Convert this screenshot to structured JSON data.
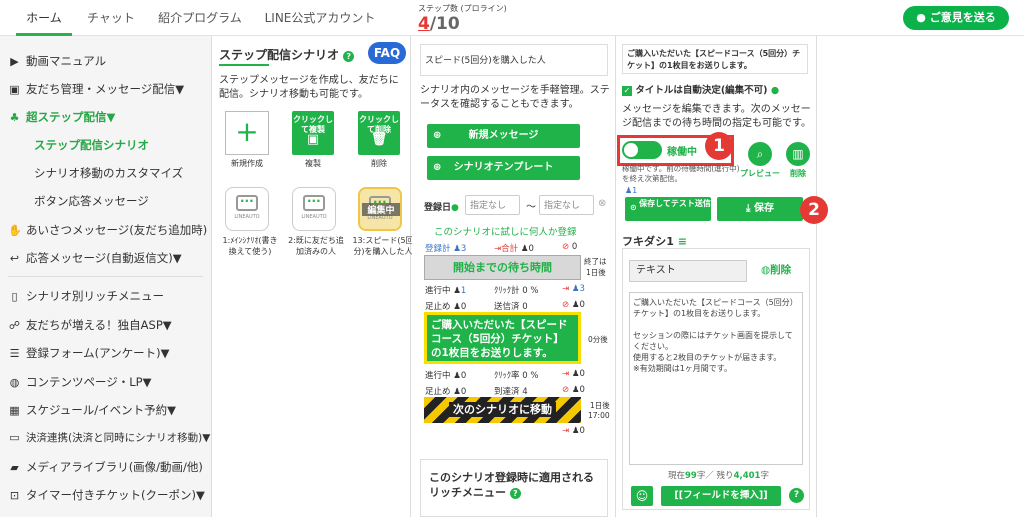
{
  "nav": {
    "tabs": [
      "ホーム",
      "チャット",
      "紹介プログラム",
      "LINE公式アカウント"
    ]
  },
  "step": {
    "label": "ステップ数 (プロライン)",
    "current": "4",
    "total": "/10"
  },
  "feedback_label": "ご意見を送る",
  "sidebar": {
    "items": [
      "動画マニュアル",
      "友だち管理・メッセージ配信▼",
      "超ステップ配信▼",
      "あいさつメッセージ(友だち追加時)",
      "応答メッセージ(自動返信文)▼",
      "シナリオ別リッチメニュー",
      "友だちが増える！独自ASP▼",
      "登録フォーム(アンケート)▼",
      "コンテンツページ・LP▼",
      "スケジュール/イベント予約▼",
      "決済連携(決済と同時にシナリオ移動)▼",
      "メディアライブラリ(画像/動画/他)",
      "タイマー付きチケット(クーポン)▼"
    ],
    "subs": [
      "ステップ配信シナリオ",
      "シナリオ移動のカスタマイズ",
      "ボタン応答メッセージ"
    ]
  },
  "col2": {
    "title": "ステップ配信シナリオ",
    "help": "?",
    "faq": "FAQ",
    "desc": "ステップメッセージを作成し、友だちに配信。シナリオ移動も可能です。",
    "actions": [
      {
        "btn": "",
        "label": "新規作成"
      },
      {
        "btn": "クリックして複製",
        "label": "複製"
      },
      {
        "btn": "クリックして削除",
        "label": "削除"
      }
    ],
    "cards": [
      {
        "label": "1:ﾒｲﾝｼﾅﾘｵ(書き換えて使う)",
        "logo": "LINEAUTO"
      },
      {
        "label": "2:既に友だち追加済みの人",
        "logo": "LINEAUTO"
      },
      {
        "label": "13:スピード(5回分)を購入した人",
        "logo": "LINEAUTO",
        "badge": "編集中"
      }
    ]
  },
  "col3": {
    "header": "スピード(5回分)を購入した人",
    "desc": "シナリオ内のメッセージを手軽管理。ステータスを確認することもできます。",
    "new_msg": "新規メッセージ",
    "template": "シナリオテンプレート",
    "reg_label": "登録日",
    "date_from": "指定なし",
    "tilde": "〜",
    "date_to": "指定なし",
    "try_link": "このシナリオに試しに何人か登録",
    "row1": {
      "registered": "登録計",
      "reg_n": "3",
      "total": "合計",
      "total_n": "0",
      "stop_n": "0"
    },
    "wait_box": "開始までの待ち時間",
    "end_label": "終了は",
    "end_time": "1日後",
    "r_prog": {
      "a": "進行中",
      "a_n": "1",
      "b": "ｸﾘｯｸ計",
      "b_n": "0 %",
      "c_n": "3"
    },
    "r_stop": {
      "a": "足止め",
      "a_n": "0",
      "b": "送信済",
      "b_n": "0",
      "c_n": "0"
    },
    "msg_box": "ご購入いただいた【スピードコース（5回分）チケット】の1枚目をお送りします。",
    "msg_time": "0分後",
    "r_prog2": {
      "a": "進行中",
      "a_n": "0",
      "b": "ｸﾘｯｸ率",
      "b_n": "0 %",
      "c_n": "0"
    },
    "r_stop2": {
      "a": "足止め",
      "a_n": "0",
      "b": "到達済",
      "b_n": "4",
      "c_n": "0"
    },
    "next_box": "次のシナリオに移動",
    "next_time1": "1日後",
    "next_time2": "17:00",
    "exit_n": "0",
    "rich_title": "このシナリオ登録時に適用されるリッチメニュー",
    "rich_help": "?"
  },
  "col4": {
    "header": "ご購入いただいた【スピードコース（5回分）チケット】の1枚目をお送りします。",
    "auto_title": "タイトルは自動決定(編集不可)",
    "desc": "メッセージを編集できます。次のメッセージ配信までの待ち時間の指定も可能です。",
    "toggle": "稼働中",
    "toggle_note": "稼働中です。前の待機時間(進行中)を終え次第配信。",
    "preview": "プレビュー",
    "delete": "削除",
    "count": "1",
    "save_test": "保存してテスト送信",
    "save": "保存",
    "fukidashi": "フキダシ1",
    "text_type": "テキスト",
    "del2": "削除",
    "msg_text": "ご購入いただいた【スピードコース（5回分）チケット】の1枚目をお送りします。\n\nセッションの際にはチケット画面を提示してください。\n使用すると2枚目のチケットが届きます。\n※有効期間は1ヶ月間です。",
    "char_prefix": "現在",
    "char_now": "99",
    "char_mid": "字／ 残り",
    "char_left": "4,401",
    "char_suffix": "字",
    "insert": "[[フィールドを挿入]]",
    "help": "?"
  },
  "colors": {
    "accent": "#20b349",
    "badge": "#e53935"
  }
}
